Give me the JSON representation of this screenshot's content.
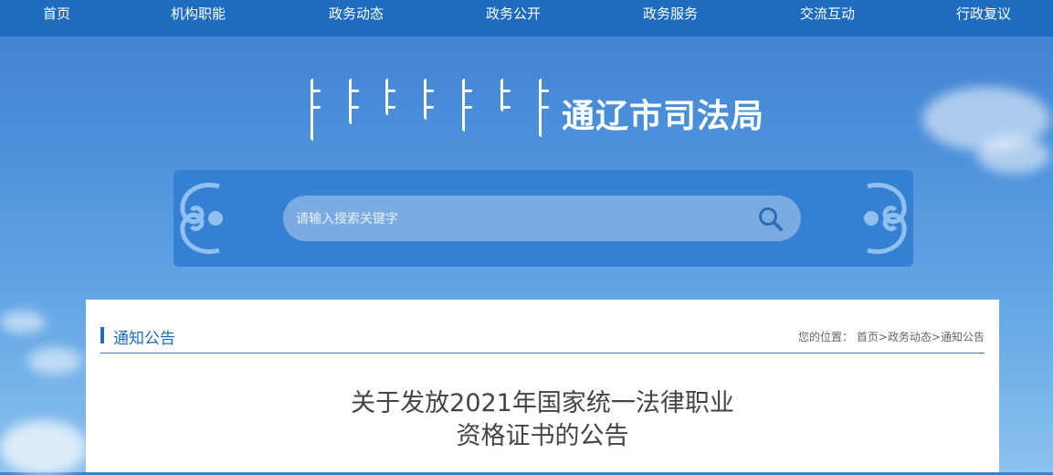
{
  "nav": {
    "items": [
      "首页",
      "机构职能",
      "政务动态",
      "政务公开",
      "政务服务",
      "交流互动",
      "行政复议"
    ]
  },
  "header": {
    "site_name": "通辽市司法局"
  },
  "search": {
    "placeholder": "请输入搜索关键字"
  },
  "section": {
    "title": "通知公告",
    "breadcrumb": {
      "prefix": "您的位置：",
      "items": [
        "首页",
        "政务动态",
        "通知公告"
      ],
      "separator": ">"
    }
  },
  "article": {
    "title_line1": "关于发放2021年国家统一法律职业",
    "title_line2": "资格证书的公告"
  },
  "colors": {
    "nav_bg": "#1e6cc0",
    "accent": "#1e6cc0",
    "search_band": "#3580d2"
  },
  "icons": [
    "search-icon",
    "mongolian-script-logo",
    "cloud-ornament-left",
    "cloud-ornament-right"
  ]
}
